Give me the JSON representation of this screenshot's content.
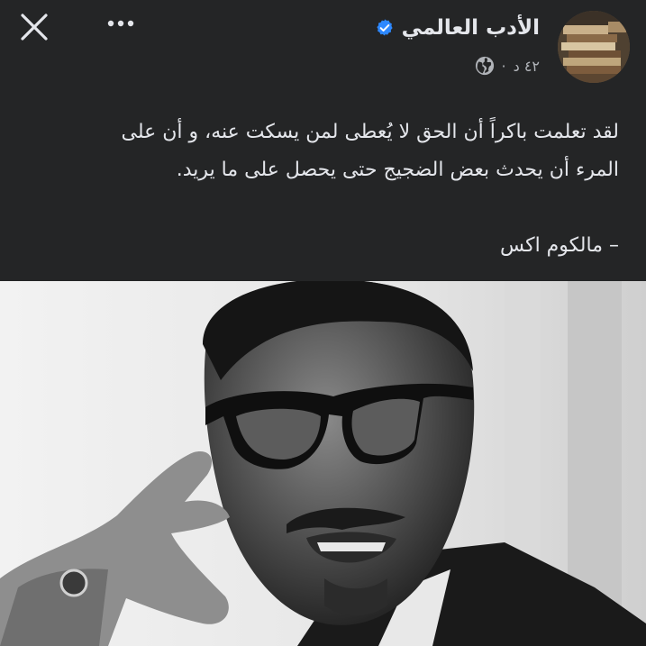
{
  "post": {
    "author_name": "الأدب العالمي",
    "timestamp": "٤٢ د",
    "separator": "·",
    "text_lines": [
      "لقد تعلمت باكراً أن الحق لا يُعطى لمن يسكت عنه، و أن على",
      "المرء أن يحدث بعض الضجيج حتى يحصل على ما يريد."
    ],
    "signature": "– مالكوم اكس"
  },
  "icons": {
    "close": "close-icon",
    "more": "more-options-icon",
    "verified": "verified-badge-icon",
    "privacy": "globe-icon"
  },
  "colors": {
    "background": "#242526",
    "text_primary": "#e4e6eb",
    "text_secondary": "#b0b3b8",
    "verified": "#2d88ff"
  }
}
